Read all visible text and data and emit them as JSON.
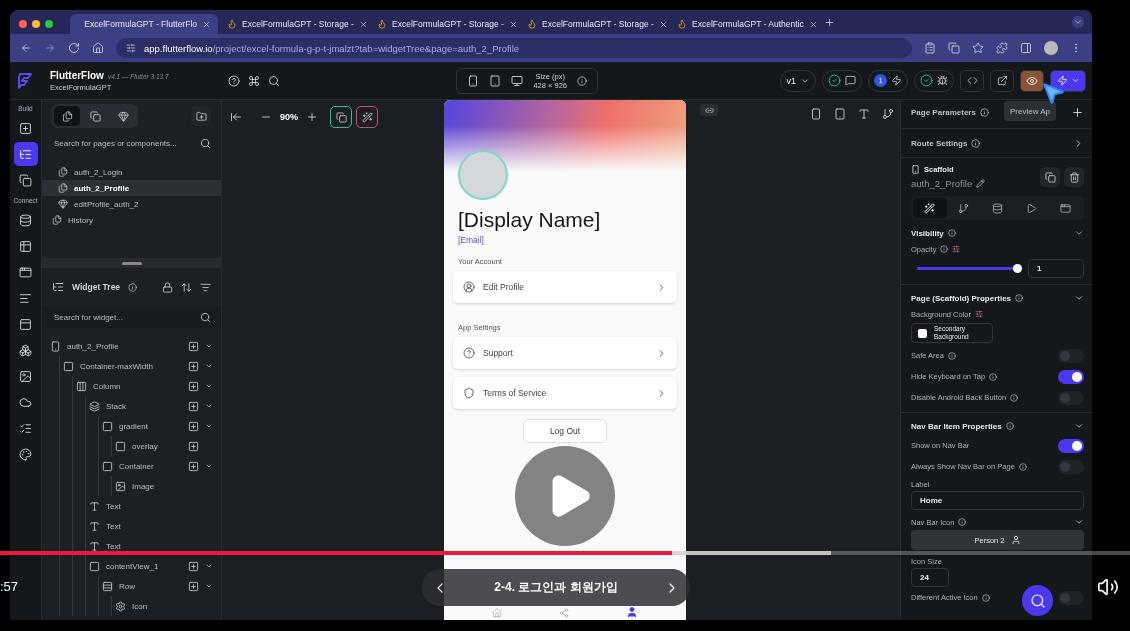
{
  "browser": {
    "tabs": [
      {
        "title": "ExcelFormulaGPT - FlutterFlo",
        "selected": true
      },
      {
        "title": "ExcelFormulaGPT - Storage -",
        "selected": false
      },
      {
        "title": "ExcelFormulaGPT - Storage -",
        "selected": false
      },
      {
        "title": "ExcelFormulaGPT - Storage -",
        "selected": false
      },
      {
        "title": "ExcelFormulaGPT - Authentic",
        "selected": false
      }
    ],
    "url_host": "app.flutterflow.io",
    "url_path": "/project/excel-formula-g-p-t-jmalzt?tab=widgetTree&page=auth_2_Profile"
  },
  "header": {
    "brand": "FlutterFlow",
    "version": "v4.1 — Flutter 3.13.7",
    "project": "ExcelFormulaGPT",
    "size_label": "Size (px)",
    "size_value": "428 × 926",
    "branch": "v1",
    "badge": "1"
  },
  "rail": [
    {
      "label": "Build",
      "items": [
        {
          "selected": false
        },
        {
          "selected": true
        },
        {
          "selected": false
        }
      ]
    },
    {
      "label": "Connect",
      "items": [
        {
          "selected": false
        },
        {
          "selected": false
        },
        {
          "selected": false
        },
        {
          "selected": false
        },
        {
          "selected": false
        },
        {
          "selected": false
        },
        {
          "selected": false
        },
        {
          "selected": false
        },
        {
          "selected": false
        },
        {
          "selected": false
        }
      ]
    }
  ],
  "pages": {
    "search_placeholder": "Search for pages or components...",
    "folder_items": [
      {
        "label": "auth_2_Login",
        "kind": "page",
        "selected": false
      },
      {
        "label": "auth_2_Profile",
        "kind": "page",
        "selected": true
      },
      {
        "label": "editProfile_auth_2",
        "kind": "component",
        "selected": false
      }
    ],
    "root_items": [
      {
        "label": "History",
        "kind": "page",
        "selected": false
      }
    ]
  },
  "widget_tree": {
    "title": "Widget Tree",
    "search_placeholder": "Search for widget...",
    "nodes": [
      {
        "label": "auth_2_Profile",
        "kind": "page",
        "children": [
          {
            "label": "Container-maxWidth",
            "kind": "container",
            "children": [
              {
                "label": "Column",
                "kind": "column",
                "children": [
                  {
                    "label": "Stack",
                    "kind": "stack",
                    "children": [
                      {
                        "label": "gradient",
                        "kind": "container",
                        "children": [
                          {
                            "label": "overlay",
                            "kind": "container"
                          }
                        ]
                      },
                      {
                        "label": "Container",
                        "kind": "container",
                        "children": [
                          {
                            "label": "Image",
                            "kind": "image"
                          }
                        ]
                      }
                    ]
                  },
                  {
                    "label": "Text",
                    "kind": "text"
                  },
                  {
                    "label": "Text",
                    "kind": "text"
                  },
                  {
                    "label": "Text",
                    "kind": "text"
                  },
                  {
                    "label": "contentView_1",
                    "kind": "container",
                    "children": [
                      {
                        "label": "Row",
                        "kind": "row",
                        "children": [
                          {
                            "label": "Icon",
                            "kind": "icon"
                          }
                        ]
                      }
                    ]
                  }
                ]
              }
            ]
          }
        ]
      }
    ]
  },
  "canvas": {
    "zoom": "90%",
    "phone": {
      "display_name": "[Display Name]",
      "email": "[Email]",
      "groups": [
        {
          "title": "Your Account",
          "rows": [
            {
              "label": "Edit Profile",
              "kind": "profile"
            }
          ]
        },
        {
          "title": "App Settings",
          "rows": [
            {
              "label": "Support",
              "kind": "help"
            },
            {
              "label": "Terms of Service",
              "kind": "shield"
            }
          ]
        }
      ],
      "logout": "Log Out",
      "nav_items": [
        {
          "selected": false
        },
        {
          "selected": false
        },
        {
          "selected": true
        }
      ]
    }
  },
  "properties": {
    "page_parameters": "Page Parameters",
    "tooltip": "Preview Ap",
    "route_settings": "Route Settings",
    "widget_type": "Scaffold",
    "widget_name": "auth_2_Profile",
    "tabs": [
      {
        "selected": true
      },
      {
        "selected": false
      },
      {
        "selected": false
      },
      {
        "selected": false
      },
      {
        "selected": false
      }
    ],
    "sections": [
      {
        "title": "Visibility",
        "rows": [
          {
            "kind": "slider",
            "label": "Opacity",
            "level": 1,
            "value": "1"
          }
        ]
      },
      {
        "title": "Page (Scaffold) Properties",
        "rows": [
          {
            "kind": "color",
            "label": "Background Color",
            "value": "Secondary Background"
          },
          {
            "kind": "toggle",
            "label": "Safe Area",
            "on": false
          },
          {
            "kind": "toggle",
            "label": "Hide Keyboard on Tap",
            "on": true
          },
          {
            "kind": "toggle",
            "label": "Disable Android Back Button",
            "on": false
          }
        ]
      },
      {
        "title": "Nav Bar Item Properties",
        "rows": [
          {
            "kind": "toggle",
            "label": "Show on Nav Bar",
            "on": true
          },
          {
            "kind": "toggle",
            "label": "Always Show Nav Bar on Page",
            "on": false
          },
          {
            "kind": "text",
            "label": "Label",
            "value": "Home"
          },
          {
            "kind": "icon_picker",
            "label": "Nav Bar Icon",
            "value": "Person 2"
          },
          {
            "kind": "number",
            "label": "Icon Size",
            "value": "24"
          },
          {
            "kind": "toggle",
            "label": "Different Active Icon",
            "on": false
          }
        ]
      }
    ]
  },
  "video": {
    "time": ":57",
    "chapter": "2-4. 로그인과 회원가입",
    "progress": {
      "level": 0.595
    },
    "buffered": {
      "level": 0.735
    }
  }
}
